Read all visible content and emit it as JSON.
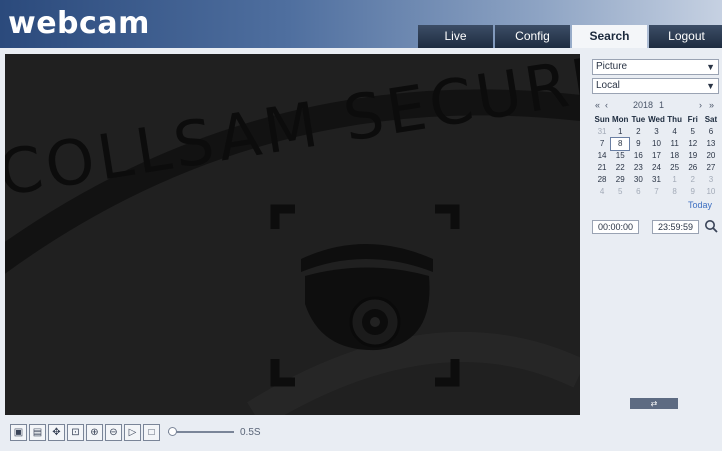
{
  "header": {
    "logo": "webcam",
    "tabs": [
      {
        "label": "Live",
        "active": false
      },
      {
        "label": "Config",
        "active": false
      },
      {
        "label": "Search",
        "active": true
      },
      {
        "label": "Logout",
        "active": false
      }
    ]
  },
  "watermark": {
    "text": "COLLSAM SECURITY"
  },
  "search_panel": {
    "type_select": "Picture",
    "source_select": "Local",
    "calendar": {
      "prev_year": "«",
      "prev_month": "‹",
      "year": "2018",
      "month": "1",
      "next_month": "›",
      "next_year": "»",
      "weekdays": [
        "Sun",
        "Mon",
        "Tue",
        "Wed",
        "Thu",
        "Fri",
        "Sat"
      ],
      "days": [
        {
          "d": "31",
          "muted": true
        },
        {
          "d": "1"
        },
        {
          "d": "2"
        },
        {
          "d": "3"
        },
        {
          "d": "4"
        },
        {
          "d": "5"
        },
        {
          "d": "6"
        },
        {
          "d": "7"
        },
        {
          "d": "8",
          "selected": true
        },
        {
          "d": "9"
        },
        {
          "d": "10"
        },
        {
          "d": "11"
        },
        {
          "d": "12"
        },
        {
          "d": "13"
        },
        {
          "d": "14"
        },
        {
          "d": "15"
        },
        {
          "d": "16"
        },
        {
          "d": "17"
        },
        {
          "d": "18"
        },
        {
          "d": "19"
        },
        {
          "d": "20"
        },
        {
          "d": "21"
        },
        {
          "d": "22"
        },
        {
          "d": "23"
        },
        {
          "d": "24"
        },
        {
          "d": "25"
        },
        {
          "d": "26"
        },
        {
          "d": "27"
        },
        {
          "d": "28"
        },
        {
          "d": "29"
        },
        {
          "d": "30"
        },
        {
          "d": "31"
        },
        {
          "d": "1",
          "muted": true
        },
        {
          "d": "2",
          "muted": true
        },
        {
          "d": "3",
          "muted": true
        },
        {
          "d": "4",
          "muted": true
        },
        {
          "d": "5",
          "muted": true
        },
        {
          "d": "6",
          "muted": true
        },
        {
          "d": "7",
          "muted": true
        },
        {
          "d": "8",
          "muted": true
        },
        {
          "d": "9",
          "muted": true
        },
        {
          "d": "10",
          "muted": true
        }
      ],
      "today_label": "Today"
    },
    "start_time": "00:00:00",
    "end_time": "23:59:59",
    "search_icon": "magnifier-icon",
    "go_label": "⇄"
  },
  "toolbar": {
    "buttons": [
      "snapshot-icon",
      "record-icon",
      "ptz-icon",
      "fit-icon",
      "zoom-in-icon",
      "zoom-out-icon",
      "play-icon",
      "stop-icon"
    ],
    "speed_value": 0,
    "speed_label": "0.5S"
  },
  "colors": {
    "header_dark": "#2b4a7c",
    "tab_bg": "#2b3a50",
    "video_bg": "#202020",
    "accent_link": "#3d6fc1"
  }
}
